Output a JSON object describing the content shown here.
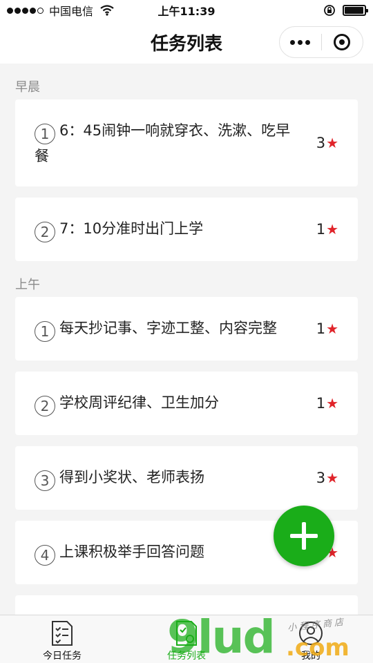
{
  "status_bar": {
    "carrier": "中国电信",
    "time": "上午11:39",
    "battery_level": 0.95
  },
  "nav": {
    "title": "任务列表"
  },
  "sections": [
    {
      "label": "早晨",
      "tasks": [
        {
          "num": "1",
          "text": "6：45闹钟一响就穿衣、洗漱、吃早餐",
          "score": "3"
        },
        {
          "num": "2",
          "text": "7：10分准时出门上学",
          "score": "1"
        }
      ]
    },
    {
      "label": "上午",
      "tasks": [
        {
          "num": "1",
          "text": "每天抄记事、字迹工整、内容完整",
          "score": "1"
        },
        {
          "num": "2",
          "text": "学校周评纪律、卫生加分",
          "score": "1"
        },
        {
          "num": "3",
          "text": "得到小奖状、老师表扬",
          "score": "3"
        },
        {
          "num": "4",
          "text": "上课积极举手回答问题",
          "score": "1"
        }
      ]
    }
  ],
  "tabs": [
    {
      "label": "今日任务",
      "icon": "checklist-icon"
    },
    {
      "label": "任务列表",
      "icon": "task-list-icon",
      "active": true
    },
    {
      "label": "我的",
      "icon": "profile-icon"
    }
  ],
  "watermark": {
    "main": "9lud",
    "suffix": ".com",
    "small": "小程序商店"
  },
  "colors": {
    "accent": "#1aad19",
    "star": "#e0242a"
  }
}
